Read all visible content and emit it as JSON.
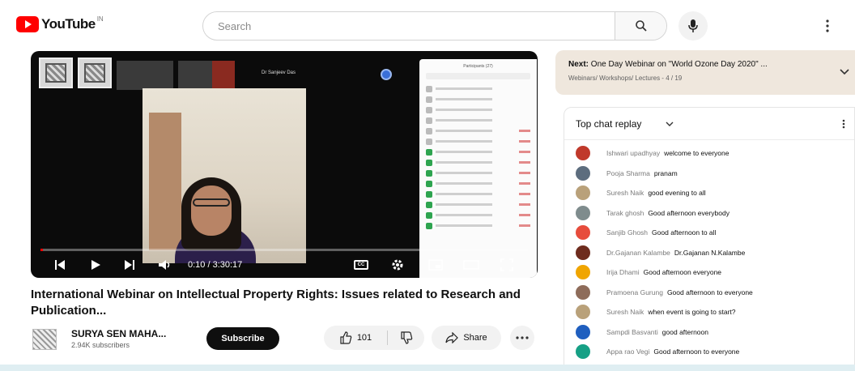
{
  "header": {
    "logo_text": "YouTube",
    "logo_region": "IN",
    "search_placeholder": "Search",
    "icons": [
      "youtube-logo-icon",
      "search-icon",
      "mic-icon",
      "more-vert-icon"
    ]
  },
  "player": {
    "participant_name": "Dr Sanjeev Das",
    "time": "0:10 / 3:30:17",
    "progress_fraction": 0.005,
    "participants_panel_title": "Participants (27)"
  },
  "video": {
    "title": "International Webinar on Intellectual Property Rights: Issues related to Research and Publication...",
    "channel_name": "SURYA SEN MAHA...",
    "channel_subs": "2.94K subscribers",
    "subscribe_label": "Subscribe",
    "like_count": "101",
    "share_label": "Share"
  },
  "next": {
    "prefix": "Next:",
    "title": "One Day Webinar on \"World Ozone Day 2020\" ...",
    "subtitle": "Webinars/ Workshops/ Lectures - 4 / 19"
  },
  "chat": {
    "title": "Top chat replay",
    "messages": [
      {
        "author": "Ishwari upadhyay",
        "text": "welcome to everyone",
        "color": "#c0392b"
      },
      {
        "author": "Pooja Sharma",
        "text": "pranam",
        "color": "#5d6d7e"
      },
      {
        "author": "Suresh Naik",
        "text": "good evening to all",
        "color": "#b9a17a"
      },
      {
        "author": "Tarak ghosh",
        "text": "Good afternoon everybody",
        "color": "#7f8c8d"
      },
      {
        "author": "Sanjib Ghosh",
        "text": "Good afternoon to all",
        "color": "#e74c3c"
      },
      {
        "author": "Dr.Gajanan Kalambe",
        "text": "Dr.Gajanan N.Kalambe",
        "color": "#6e2c1e"
      },
      {
        "author": "Irija Dhami",
        "text": "Good afternoon everyone",
        "color": "#f0a500"
      },
      {
        "author": "Pramoena Gurung",
        "text": "Good afternoon to everyone",
        "color": "#8e6c5a"
      },
      {
        "author": "Suresh Naik",
        "text": "when event is going to start?",
        "color": "#b9a17a"
      },
      {
        "author": "Sampdi Basvanti",
        "text": "good afternoon",
        "color": "#1f5fbf"
      },
      {
        "author": "Appa rao Vegi",
        "text": "Good afternoon to everyone",
        "color": "#16a085"
      }
    ]
  }
}
